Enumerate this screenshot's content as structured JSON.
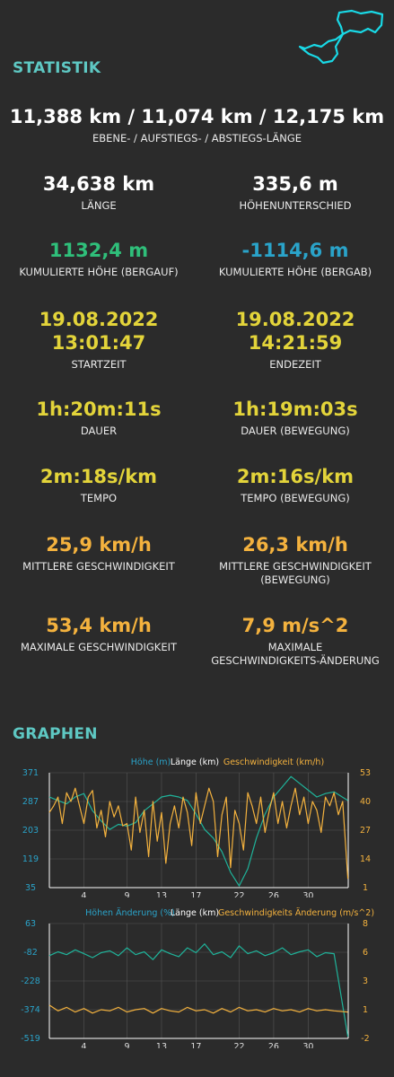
{
  "colors": {
    "accent": "#5ec8c3",
    "green": "#2fbf7a",
    "blue": "#2aa3c9",
    "yellow": "#e3d43a",
    "orange": "#f4b23e",
    "teal": "#1fb39a",
    "route": "#19d9e6"
  },
  "route_icon": "route-map-thumbnail",
  "stats": {
    "title": "STATISTIK",
    "lengths": {
      "value": "11,388 km / 11,074 km / 12,175 km",
      "label": "EBENE- / AUFSTIEGS- / ABSTIEGS-LÄNGE"
    },
    "length": {
      "value": "34,638 km",
      "label": "LÄNGE"
    },
    "height_diff": {
      "value": "335,6 m",
      "label": "HÖHENUNTERSCHIED"
    },
    "climb_up": {
      "value": "1132,4 m",
      "label": "KUMULIERTE HÖHE (BERGAUF)"
    },
    "climb_down": {
      "value": "-1114,6 m",
      "label": "KUMULIERTE HÖHE (BERGAB)"
    },
    "start": {
      "date": "19.08.2022",
      "time": "13:01:47",
      "label": "STARTZEIT"
    },
    "end": {
      "date": "19.08.2022",
      "time": "14:21:59",
      "label": "ENDEZEIT"
    },
    "duration": {
      "value": "1h:20m:11s",
      "label": "DAUER"
    },
    "duration_moving": {
      "value": "1h:19m:03s",
      "label": "DAUER (BEWEGUNG)"
    },
    "pace": {
      "value": "2m:18s/km",
      "label": "TEMPO"
    },
    "pace_moving": {
      "value": "2m:16s/km",
      "label": "TEMPO (BEWEGUNG)"
    },
    "avg_speed": {
      "value": "25,9 km/h",
      "label": "MITTLERE GESCHWINDIGKEIT"
    },
    "avg_speed_moving": {
      "value": "26,3 km/h",
      "label_1": "MITTLERE GESCHWINDIGKEIT",
      "label_2": "(BEWEGUNG)"
    },
    "max_speed": {
      "value": "53,4 km/h",
      "label": "MAXIMALE GESCHWINDIGKEIT"
    },
    "max_accel": {
      "value": "7,9 m/s^2",
      "label_1": "MAXIMALE",
      "label_2": "GESCHWINDIGKEITS-ÄNDERUNG"
    }
  },
  "graphs": {
    "title": "GRAPHEN"
  },
  "chart_data": [
    {
      "type": "line",
      "legend": [
        "Höhe (m)",
        "Länge (km)",
        "Geschwindigkeit (km/h)"
      ],
      "x_ticks": [
        "4",
        "9",
        "13",
        "17",
        "22",
        "26",
        "30"
      ],
      "x_tick_values": [
        4,
        9,
        13,
        17,
        22,
        26,
        30
      ],
      "xlim": [
        0,
        34.64
      ],
      "y_left_ticks": [
        "371",
        "287",
        "203",
        "119",
        "35"
      ],
      "y_left_lim": [
        35,
        371
      ],
      "y_right_ticks": [
        "53",
        "40",
        "27",
        "14",
        "1"
      ],
      "y_right_lim": [
        1,
        53
      ],
      "series": [
        {
          "name": "Höhe (m)",
          "axis": "left",
          "color": "#1fb39a",
          "x": [
            0,
            1,
            2,
            3,
            4,
            5,
            6,
            7,
            8,
            9,
            10,
            11,
            12,
            13,
            14,
            15,
            16,
            17,
            18,
            19,
            20,
            21,
            22,
            23,
            24,
            25,
            26,
            27,
            28,
            29,
            30,
            31,
            32,
            33,
            34.6
          ],
          "values": [
            300,
            290,
            280,
            300,
            310,
            260,
            230,
            205,
            220,
            215,
            225,
            260,
            280,
            300,
            305,
            300,
            290,
            250,
            205,
            180,
            140,
            80,
            40,
            90,
            180,
            250,
            300,
            330,
            360,
            340,
            320,
            300,
            310,
            315,
            290
          ]
        },
        {
          "name": "Geschwindigkeit (km/h)",
          "axis": "right",
          "color": "#f4b23e",
          "x": [
            0,
            0.5,
            1,
            1.5,
            2,
            2.5,
            3,
            3.5,
            4,
            4.5,
            5,
            5.5,
            6,
            6.5,
            7,
            7.5,
            8,
            8.5,
            9,
            9.5,
            10,
            10.5,
            11,
            11.5,
            12,
            12.5,
            13,
            13.5,
            14,
            14.5,
            15,
            15.5,
            16,
            16.5,
            17,
            17.5,
            18,
            18.5,
            19,
            19.5,
            20,
            20.5,
            21,
            21.5,
            22,
            22.5,
            23,
            23.5,
            24,
            24.5,
            25,
            25.5,
            26,
            26.5,
            27,
            27.5,
            28,
            28.5,
            29,
            29.5,
            30,
            30.5,
            31,
            31.5,
            32,
            32.5,
            33,
            33.5,
            34,
            34.6
          ],
          "values": [
            35,
            38,
            42,
            30,
            44,
            40,
            46,
            38,
            30,
            42,
            45,
            28,
            36,
            24,
            40,
            33,
            38,
            29,
            30,
            18,
            42,
            26,
            36,
            15,
            40,
            22,
            35,
            12,
            30,
            38,
            28,
            42,
            35,
            20,
            44,
            30,
            38,
            46,
            40,
            15,
            34,
            42,
            10,
            36,
            30,
            18,
            44,
            38,
            30,
            42,
            26,
            36,
            44,
            30,
            40,
            28,
            38,
            46,
            34,
            42,
            30,
            40,
            36,
            26,
            42,
            38,
            44,
            34,
            40,
            5
          ]
        }
      ]
    },
    {
      "type": "line",
      "legend": [
        "Höhen Änderung (%)",
        "Länge (km)",
        "Geschwindigkeits Änderung (m/s^2)"
      ],
      "x_ticks": [
        "4",
        "9",
        "13",
        "17",
        "22",
        "26",
        "30"
      ],
      "x_tick_values": [
        4,
        9,
        13,
        17,
        22,
        26,
        30
      ],
      "xlim": [
        0,
        34.64
      ],
      "y_left_ticks": [
        "63",
        "-82",
        "-228",
        "-374",
        "-519"
      ],
      "y_left_lim": [
        -519,
        63
      ],
      "y_right_ticks": [
        "8",
        "6",
        "3",
        "1",
        "-2"
      ],
      "y_right_lim": [
        -2,
        8
      ],
      "series": [
        {
          "name": "Höhen Änderung (%)",
          "axis": "left",
          "color": "#1fb39a",
          "x": [
            0,
            1,
            2,
            3,
            4,
            5,
            6,
            7,
            8,
            9,
            10,
            11,
            12,
            13,
            14,
            15,
            16,
            17,
            18,
            19,
            20,
            21,
            22,
            23,
            24,
            25,
            26,
            27,
            28,
            29,
            30,
            31,
            32,
            33,
            34.6
          ],
          "values": [
            -100,
            -80,
            -95,
            -70,
            -90,
            -110,
            -85,
            -75,
            -100,
            -60,
            -95,
            -80,
            -120,
            -70,
            -90,
            -105,
            -60,
            -85,
            -40,
            -95,
            -80,
            -110,
            -50,
            -90,
            -75,
            -100,
            -85,
            -60,
            -95,
            -80,
            -70,
            -105,
            -85,
            -90,
            -510
          ]
        },
        {
          "name": "Geschwindigkeits Änderung (m/s^2)",
          "axis": "right",
          "color": "#f4b23e",
          "x": [
            0,
            1,
            2,
            3,
            4,
            5,
            6,
            7,
            8,
            9,
            10,
            11,
            12,
            13,
            14,
            15,
            16,
            17,
            18,
            19,
            20,
            21,
            22,
            23,
            24,
            25,
            26,
            27,
            28,
            29,
            30,
            31,
            32,
            33,
            34.6
          ],
          "values": [
            0.9,
            0.4,
            0.7,
            0.3,
            0.6,
            0.2,
            0.5,
            0.4,
            0.7,
            0.3,
            0.5,
            0.6,
            0.2,
            0.6,
            0.4,
            0.3,
            0.7,
            0.4,
            0.5,
            0.2,
            0.6,
            0.3,
            0.7,
            0.4,
            0.5,
            0.3,
            0.6,
            0.4,
            0.5,
            0.3,
            0.6,
            0.4,
            0.5,
            0.4,
            0.3
          ]
        }
      ]
    }
  ]
}
